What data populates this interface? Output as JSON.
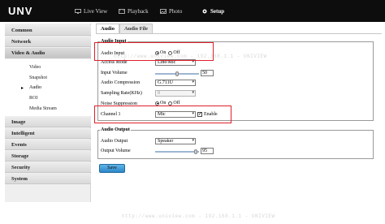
{
  "app": {
    "logo": "UNV",
    "nav": [
      {
        "label": "Live View",
        "icon": "monitor-icon"
      },
      {
        "label": "Playback",
        "icon": "film-icon"
      },
      {
        "label": "Photo",
        "icon": "photo-icon"
      },
      {
        "label": "Setup",
        "icon": "gear-icon"
      }
    ]
  },
  "sidebar": {
    "categories": [
      "Common",
      "Network",
      "Video & Audio",
      "Image",
      "Intelligent",
      "Events",
      "Storage",
      "Security",
      "System"
    ],
    "sub_items": [
      "Video",
      "Snapshot",
      "Audio",
      "ROI",
      "Media Stream"
    ],
    "active_sub": "Audio"
  },
  "tabs": [
    "Audio",
    "Audio File"
  ],
  "audio_input": {
    "title": "Audio Input",
    "audio_input_label": "Audio Input",
    "on_label": "On",
    "off_label": "Off",
    "access_mode_label": "Access Mode",
    "access_mode_value": "Line/Mic",
    "input_volume_label": "Input Volume",
    "input_volume_value": "50",
    "audio_compression_label": "Audio Compression",
    "audio_compression_value": "G.711U",
    "sampling_rate_label": "Sampling Rate(KHz)",
    "sampling_rate_value": "8",
    "noise_suppression_label": "Noise Suppression",
    "channel_label": "Channel 1",
    "channel_value": "Mic",
    "enable_label": "Enable"
  },
  "audio_output": {
    "title": "Audio Output",
    "audio_output_label": "Audio Output",
    "audio_output_value": "Speaker",
    "output_volume_label": "Output Volume",
    "output_volume_value": "95"
  },
  "save_label": "Save",
  "watermark_text": "http://www.uniview.com - 192.168.1.1 - UNIVIEW",
  "colors": {
    "topbar": "#0d0d0d",
    "highlight_box": "#e0202a",
    "save_button": "#3a95d3"
  }
}
